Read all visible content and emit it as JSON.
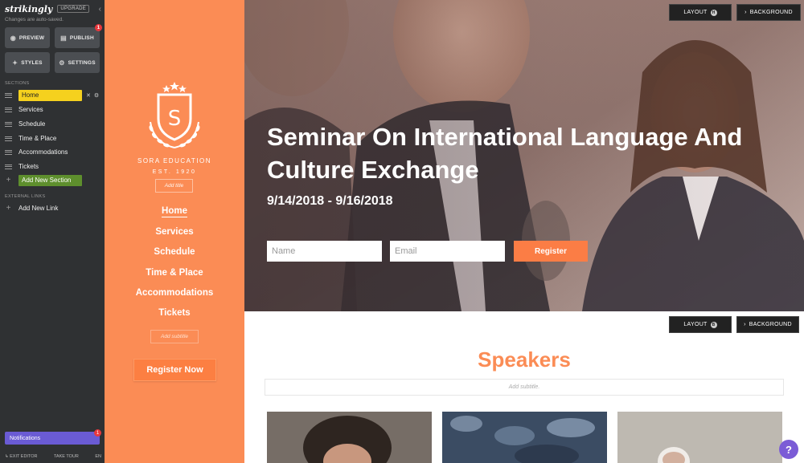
{
  "editor": {
    "logo": "strikingly",
    "upgrade_label": "UPGRADE",
    "autosave": "Changes are auto-saved.",
    "buttons": {
      "preview": "PREVIEW",
      "publish": "PUBLISH",
      "publish_badge": "1",
      "styles": "STYLES",
      "settings": "SETTINGS"
    },
    "sections_heading": "SECTIONS",
    "sections": [
      "Home",
      "Services",
      "Schedule",
      "Time & Place",
      "Accommodations",
      "Tickets"
    ],
    "add_section": "Add New Section",
    "external_heading": "EXTERNAL LINKS",
    "add_link": "Add New Link",
    "notifications": "Notifications",
    "notifications_badge": "1",
    "footer": {
      "exit": "EXIT EDITOR",
      "tour": "TAKE TOUR",
      "lang": "EN"
    }
  },
  "site_nav": {
    "brand": "SORA EDUCATION",
    "est": "EST. 1920",
    "crest_letter": "S",
    "add_title": "Add title",
    "links": [
      "Home",
      "Services",
      "Schedule",
      "Time & Place",
      "Accommodations",
      "Tickets"
    ],
    "add_subtitle": "Add subtitle",
    "cta": "Register Now",
    "accent": "#fb8c55"
  },
  "hero": {
    "title": "Seminar On International Language And Culture Exchange",
    "date": "9/14/2018 - 9/16/2018",
    "name_placeholder": "Name",
    "email_placeholder": "Email",
    "register": "Register",
    "layout_btn": "LAYOUT",
    "layout_key": "H",
    "background_btn": "BACKGROUND"
  },
  "speakers": {
    "layout_btn": "LAYOUT",
    "layout_key": "B",
    "background_btn": "BACKGROUND",
    "title": "Speakers",
    "subtitle": "Add subtitle."
  },
  "help_icon": "?"
}
